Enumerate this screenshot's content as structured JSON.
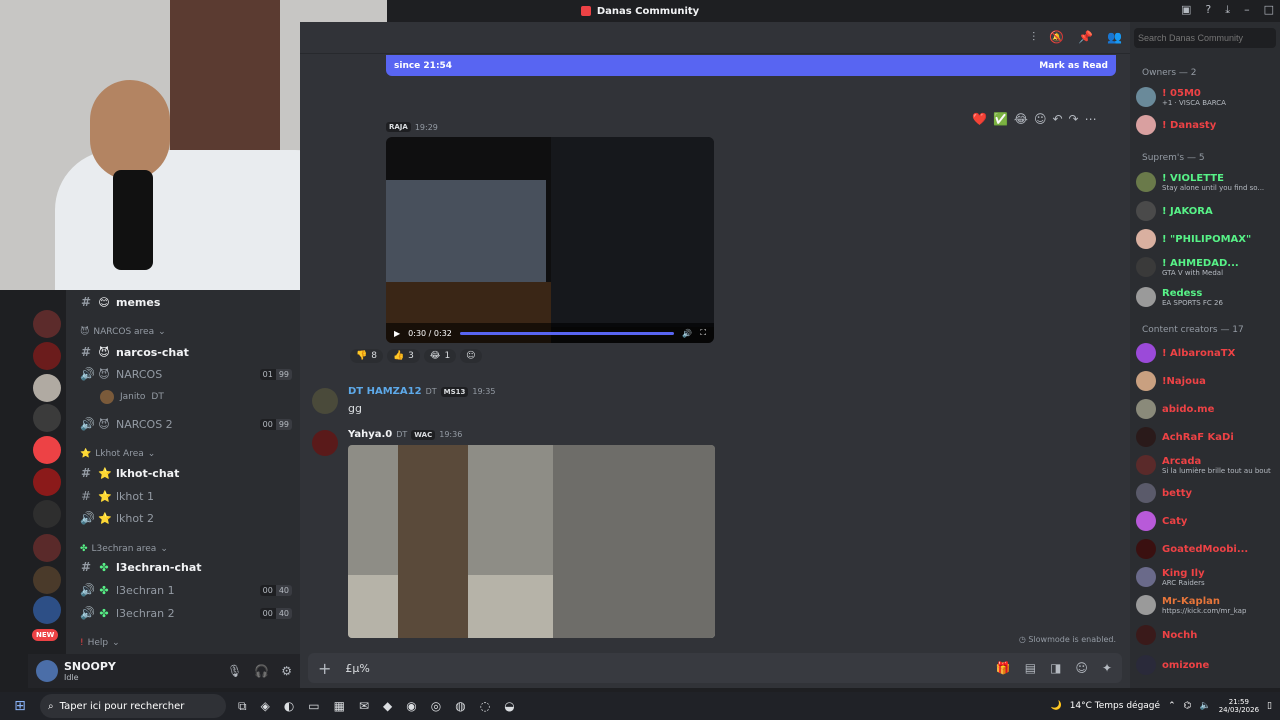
{
  "window": {
    "title": "Danas Community"
  },
  "header": {
    "search_placeholder": "Search Danas Community"
  },
  "banner": {
    "text": "since 21:54",
    "action": "Mark as Read"
  },
  "messages": [
    {
      "author": "",
      "tag": "RAJA",
      "time": "19:29",
      "video_time": "0:30 / 0:32"
    },
    {
      "author": "DT HAMZA12",
      "badge": "DT",
      "tag": "MS13",
      "time": "19:35",
      "text": "gg"
    },
    {
      "author": "Yahya.0",
      "badge": "DT",
      "tag": "WAC",
      "time": "19:36"
    }
  ],
  "reactions": [
    {
      "emoji": "👎",
      "count": "8"
    },
    {
      "emoji": "👍",
      "count": "3"
    },
    {
      "emoji": "😂",
      "count": "1"
    }
  ],
  "slowmode": "Slowmode is enabled.",
  "composer": {
    "text": "£µ%"
  },
  "channels": {
    "memes": "memes",
    "narcos_area": "NARCOS area",
    "narcos_chat": "narcos-chat",
    "narcos": "NARCOS",
    "narcos_count": [
      "01",
      "99"
    ],
    "janito": "Janito",
    "janito_badge": "DT",
    "narcos2": "NARCOS 2",
    "narcos2_count": [
      "00",
      "99"
    ],
    "lkhot_area": "Lkhot Area",
    "lkhot_chat": "lkhot-chat",
    "lkhot1": "lkhot 1",
    "lkhot2": "lkhot 2",
    "l3echran_area": "L3echran area",
    "l3echran_chat": "l3echran-chat",
    "l3echran1": "l3echran 1",
    "l3echran1_count": [
      "00",
      "40"
    ],
    "l3echran2": "l3echran 2",
    "l3echran2_count": [
      "00",
      "40"
    ],
    "help": "Help"
  },
  "rail": {
    "new_badge": "NEW"
  },
  "user": {
    "name": "SNOOPY",
    "status": "Idle"
  },
  "members": {
    "owners": "Owners — 2",
    "suprem": "Suprem's — 5",
    "content": "Content creators — 17",
    "list": [
      {
        "name": "! 05M0",
        "status": "+1 · VISCA BARCA",
        "color": "#ed4245"
      },
      {
        "name": "! Danasty",
        "status": "",
        "color": "#ed4245"
      },
      {
        "name": "! VIOLETTE",
        "status": "Stay alone until you find so...",
        "color": "#57f287"
      },
      {
        "name": "! JAKORA",
        "status": "",
        "color": "#57f287"
      },
      {
        "name": "! \"PHILIPOMAX\"",
        "status": "",
        "color": "#57f287"
      },
      {
        "name": "! AHMEDAD...",
        "status": "GTA V with Medal",
        "color": "#57f287"
      },
      {
        "name": "Redess",
        "status": "EA SPORTS FC 26",
        "color": "#57f287"
      },
      {
        "name": "! AlbaronaTX",
        "status": "",
        "color": "#ed4245"
      },
      {
        "name": "!Najoua",
        "status": "",
        "color": "#ed4245"
      },
      {
        "name": "abido.me",
        "status": "",
        "color": "#ed4245"
      },
      {
        "name": "AchRaF KaDi",
        "status": "",
        "color": "#ed4245"
      },
      {
        "name": "Arcada",
        "status": "Si la lumière brille tout au bout",
        "color": "#ed4245"
      },
      {
        "name": "betty",
        "status": "",
        "color": "#ed4245"
      },
      {
        "name": "Caty",
        "status": "",
        "color": "#ed4245"
      },
      {
        "name": "GoatedMoobi...",
        "status": "",
        "color": "#ed4245"
      },
      {
        "name": "King Ily",
        "status": "ARC Raiders",
        "color": "#ed4245"
      },
      {
        "name": "Mr-Kaplan",
        "status": "https://kick.com/mr_kap",
        "color": "#ed4245"
      },
      {
        "name": "Nochh",
        "status": "",
        "color": "#ed4245"
      },
      {
        "name": "omizone",
        "status": "",
        "color": "#ed4245"
      }
    ]
  },
  "taskbar": {
    "search": "Taper ici pour rechercher",
    "weather": "14°C  Temps dégagé",
    "time": "21:59",
    "date": "24/03/2026"
  }
}
